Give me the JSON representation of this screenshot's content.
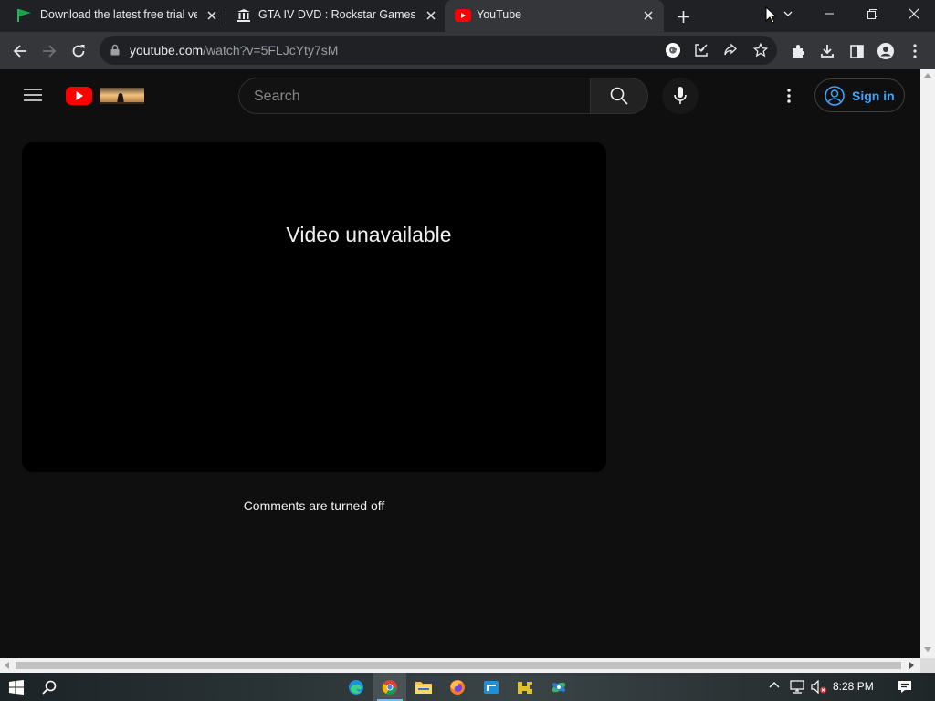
{
  "browser": {
    "tabs": [
      {
        "title": "Download the latest free trial ver",
        "icon": "flag-icon",
        "active": false
      },
      {
        "title": "GTA IV DVD : Rockstar Games : Fr",
        "icon": "archive-icon",
        "active": false
      },
      {
        "title": "YouTube",
        "icon": "youtube-icon",
        "active": true
      }
    ],
    "url_host": "youtube.com",
    "url_path": "/watch?v=5FLJcYty7sM"
  },
  "youtube": {
    "search_placeholder": "Search",
    "sign_in_label": "Sign in",
    "video_message": "Video unavailable",
    "comments_message": "Comments are turned off"
  },
  "taskbar": {
    "clock": "8:28 PM",
    "apps": [
      "edge-icon",
      "chrome-icon",
      "file-explorer-icon",
      "firefox-icon",
      "app-icon",
      "app-icon-2",
      "app-icon-3"
    ]
  },
  "colors": {
    "accent_blue": "#3ea6ff",
    "youtube_red": "#ff0000",
    "page_bg": "#0f0f0f"
  }
}
